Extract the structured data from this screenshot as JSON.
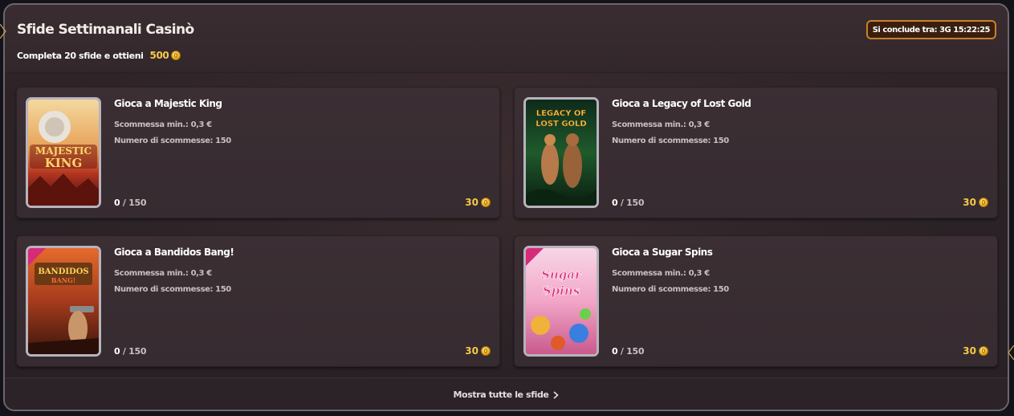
{
  "header": {
    "title": "Sfide Settimanali Casinò",
    "subtitle": "Completa 20 sfide e ottieni",
    "reward": "500",
    "timer": "Si conclude tra: 3G 15:22:25"
  },
  "challenges": [
    {
      "title": "Gioca a Majestic King",
      "min_bet": "Scommessa min.: 0,3 €",
      "bets": "Numero di scommesse: 150",
      "progress": "0",
      "total": "150",
      "reward": "30",
      "thumb_text": "MAJESTIC KING"
    },
    {
      "title": "Gioca a Legacy of Lost Gold",
      "min_bet": "Scommessa min.: 0,3 €",
      "bets": "Numero di scommesse: 150",
      "progress": "0",
      "total": "150",
      "reward": "30",
      "thumb_text": "LEGACY OF LOST GOLD"
    },
    {
      "title": "Gioca a Bandidos Bang!",
      "min_bet": "Scommessa min.: 0,3 €",
      "bets": "Numero di scommesse: 150",
      "progress": "0",
      "total": "150",
      "reward": "30",
      "thumb_text": "BANDIDOS BANG!"
    },
    {
      "title": "Gioca a Sugar Spins",
      "min_bet": "Scommessa min.: 0,3 €",
      "bets": "Numero di scommesse: 150",
      "progress": "0",
      "total": "150",
      "reward": "30",
      "thumb_text": "SUGAR SPINS"
    }
  ],
  "footer": {
    "show_all": "Mostra tutte le sfide"
  },
  "colors": {
    "accent_gold": "#f5c94a",
    "timer_border": "#c9802c",
    "panel_bg": "#2f2428"
  }
}
